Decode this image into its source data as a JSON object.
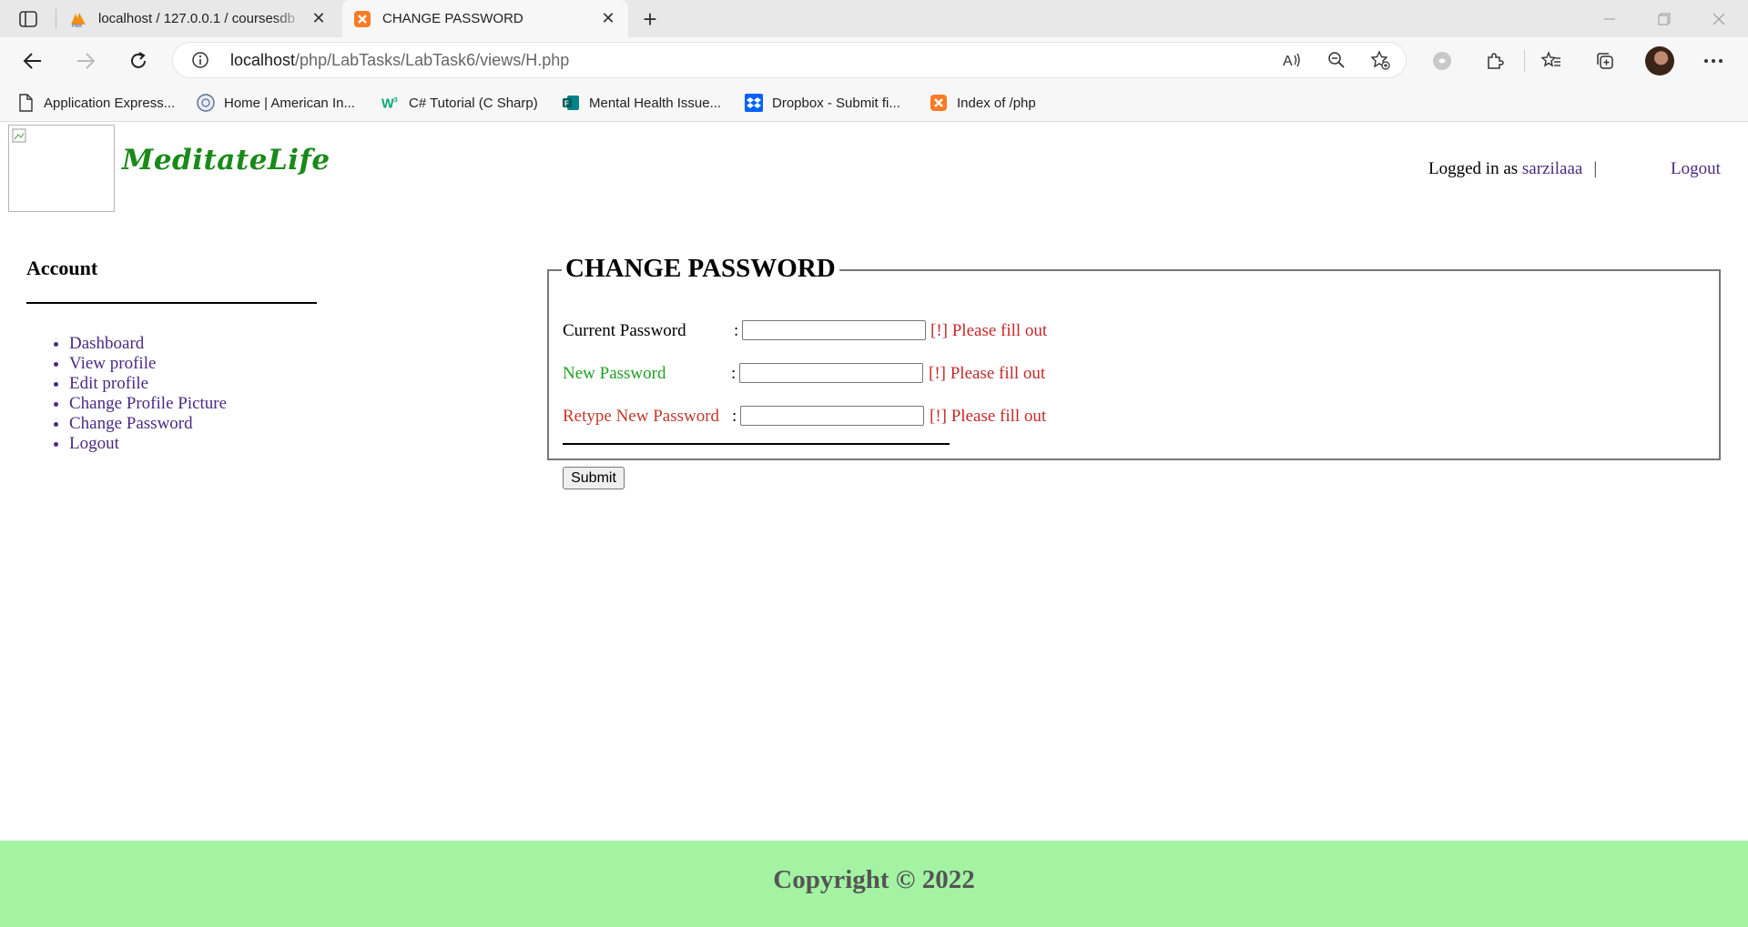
{
  "browser": {
    "tabs": [
      {
        "title": "localhost / 127.0.0.1 / coursesdb",
        "icon": "phpmyadmin-icon",
        "active": false
      },
      {
        "title": "CHANGE PASSWORD",
        "icon": "xampp-icon",
        "active": true
      }
    ],
    "url": {
      "host": "localhost",
      "path": "/php/LabTasks/LabTask6/views/H.php"
    },
    "bookmarks": [
      {
        "label": "Application Express...",
        "icon": "page-icon"
      },
      {
        "label": "Home | American In...",
        "icon": "globe-icon"
      },
      {
        "label": "C# Tutorial (C Sharp)",
        "icon": "w3schools-icon"
      },
      {
        "label": "Mental Health Issue...",
        "icon": "forms-icon"
      },
      {
        "label": "Dropbox - Submit fi...",
        "icon": "dropbox-icon"
      },
      {
        "label": "Index of /php",
        "icon": "xampp-icon"
      }
    ]
  },
  "header": {
    "site_name": "MeditateLife",
    "logged_in_prefix": "Logged in as ",
    "username": "sarzilaaa",
    "separator": "|",
    "logout": "Logout"
  },
  "sidebar": {
    "title": "Account",
    "items": [
      "Dashboard",
      "View profile",
      "Edit profile",
      "Change Profile Picture",
      "Change Password",
      "Logout"
    ]
  },
  "form": {
    "legend": "CHANGE PASSWORD",
    "fields": [
      {
        "label": "Current Password",
        "colon": ":",
        "value": "",
        "error": "[!] Please fill out",
        "label_color": "#000000"
      },
      {
        "label": "New Password",
        "colon": ":",
        "value": "",
        "error": "[!] Please fill out",
        "label_color": "#1fa01f"
      },
      {
        "label": "Retype New Password",
        "colon": ":",
        "value": "",
        "error": "[!] Please fill out",
        "label_color": "#c0392b"
      }
    ],
    "submit": "Submit"
  },
  "footer": {
    "text": "Copyright © 2022"
  },
  "colors": {
    "link": "#4b2a83",
    "error": "#c62828",
    "footer_bg": "#a3f3a3",
    "brand": "#1a8a1a"
  }
}
